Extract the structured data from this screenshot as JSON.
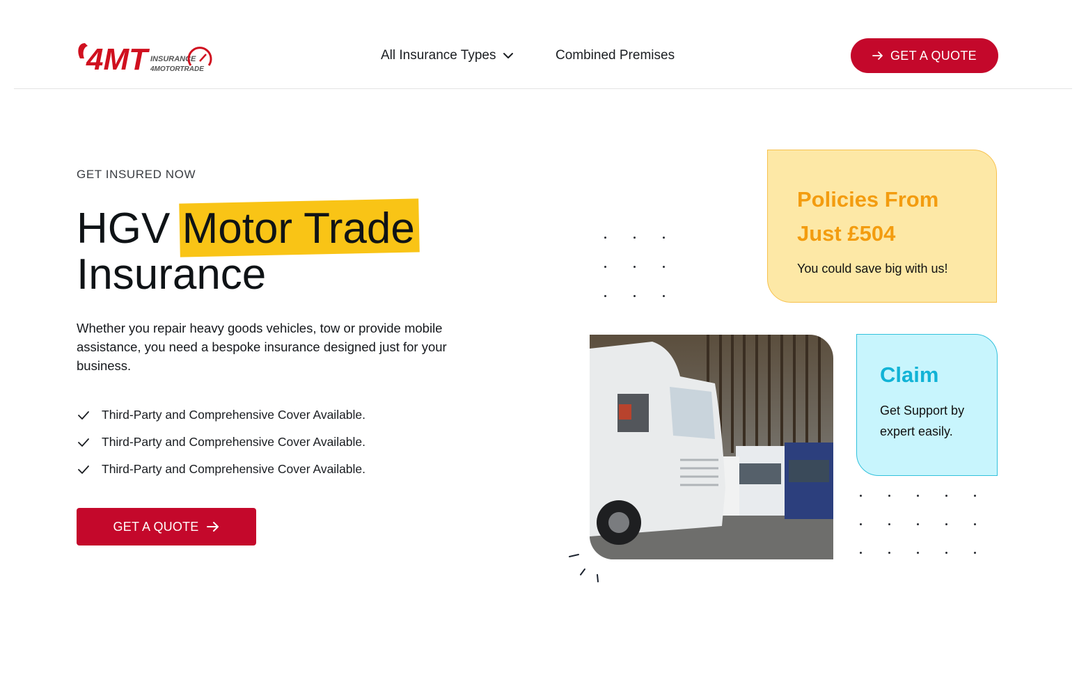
{
  "header": {
    "logo_text": "4MT",
    "logo_sub_top": "INSURANCE",
    "logo_sub_bottom": "4MOTORTRADE",
    "nav": [
      {
        "label": "All Insurance Types",
        "icon": "chevron-down-icon"
      },
      {
        "label": "Combined Premises"
      }
    ],
    "cta_label": "GET A QUOTE",
    "cta_icon": "arrow-right-icon"
  },
  "hero": {
    "eyebrow": "GET INSURED NOW",
    "title_before": "HGV",
    "title_highlight": "Motor Trade",
    "title_after": "Insurance",
    "lead": "Whether you repair heavy goods vehicles, tow or provide mobile assistance, you need a bespoke insurance designed just for your business.",
    "features": [
      "Third-Party and Comprehensive Cover Available.",
      "Third-Party and Comprehensive Cover Available.",
      "Third-Party and Comprehensive Cover Available."
    ],
    "feature_icon": "check-icon",
    "cta_label": "GET A QUOTE",
    "cta_icon": "arrow-right-icon"
  },
  "cards": {
    "policy": {
      "title_line1": "Policies From",
      "title_line2": "Just £504",
      "subtitle": "You could save big with us!"
    },
    "claim": {
      "title": "Claim",
      "subtitle": "Get Support by expert easily."
    }
  },
  "colors": {
    "brand_red": "#c4082b",
    "highlight_yellow": "#f9c416",
    "policy_bg": "#fde8a6",
    "policy_accent": "#f39c0f",
    "claim_bg": "#c8f5fd",
    "claim_accent": "#11b3d6"
  }
}
